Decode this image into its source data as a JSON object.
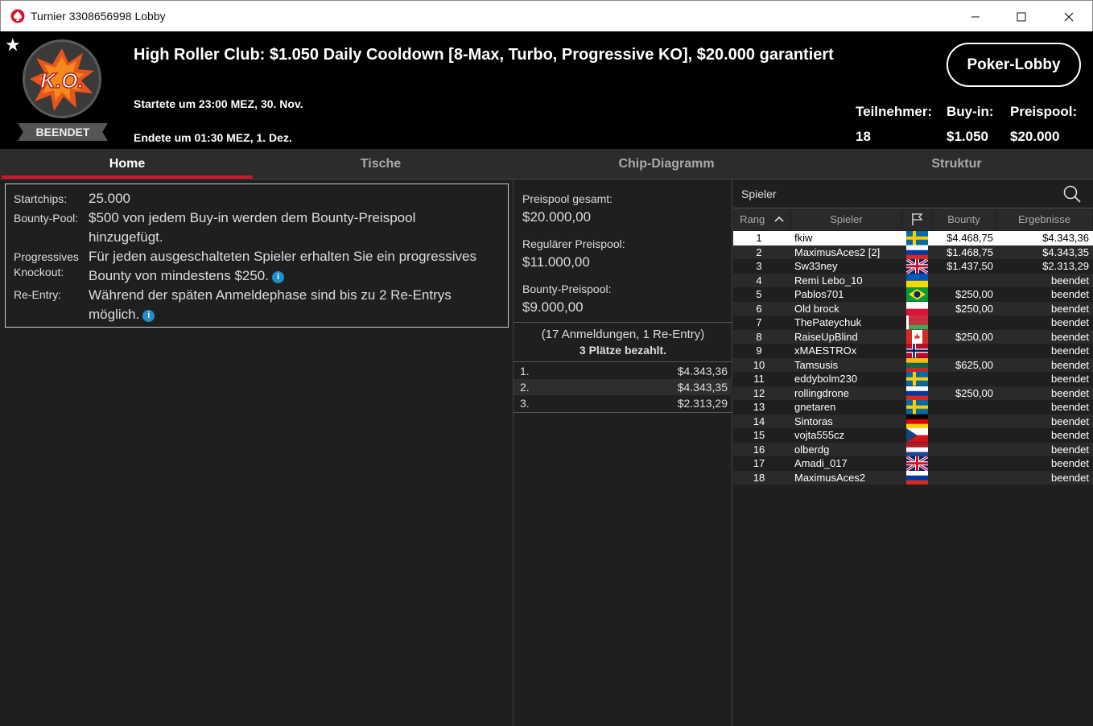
{
  "window": {
    "title": "Turnier 3308656998 Lobby"
  },
  "header": {
    "status": "BEENDET",
    "title": "High Roller Club: $1.050 Daily Cooldown [8-Max, Turbo, Progressive KO], $20.000 garantiert",
    "started": "Startete um 23:00 MEZ, 30. Nov.",
    "ended": "Endete um 01:30 MEZ, 1. Dez.",
    "lobby_button": "Poker-Lobby",
    "participants_label": "Teilnehmer:",
    "participants_value": "18",
    "buyin_label": "Buy-in:",
    "buyin_value": "$1.050",
    "prizepool_label": "Preispool:",
    "prizepool_value": "$20.000"
  },
  "tabs": [
    "Home",
    "Tische",
    "Chip-Diagramm",
    "Struktur"
  ],
  "info": {
    "startchips_label": "Startchips:",
    "startchips_value": "25.000",
    "bounty_label": "Bounty-Pool:",
    "bounty_value_1": "$500 von jedem Buy-in werden dem Bounty-Preispool",
    "bounty_value_2": "hinzugefügt.",
    "pko_label_1": "Progressives",
    "pko_label_2": "Knockout:",
    "pko_value_1": "Für jeden ausgeschalteten Spieler erhalten Sie ein progressives",
    "pko_value_2": "Bounty von mindestens $250.",
    "reentry_label": "Re-Entry:",
    "reentry_value_1": "Während der späten Anmeldephase sind bis zu 2 Re-Entrys",
    "reentry_value_2": "möglich."
  },
  "prize": {
    "total_label": "Preispool gesamt:",
    "total_value": "$20.000,00",
    "regular_label": "Regulärer Preispool:",
    "regular_value": "$11.000,00",
    "bounty_label": "Bounty-Preispool:",
    "bounty_value": "$9.000,00",
    "entries": "(17 Anmeldungen, 1 Re-Entry)",
    "paid": "3 Plätze bezahlt.",
    "payouts": [
      {
        "pos": "1.",
        "amount": "$4.343,36"
      },
      {
        "pos": "2.",
        "amount": "$4.343,35"
      },
      {
        "pos": "3.",
        "amount": "$2.313,29"
      }
    ]
  },
  "players": {
    "title": "Spieler",
    "columns": {
      "rank": "Rang",
      "player": "Spieler",
      "bounty": "Bounty",
      "result": "Ergebnisse"
    },
    "rows": [
      {
        "rank": "1",
        "name": "fkiw",
        "flag": "se",
        "bounty": "$4.468,75",
        "result": "$4.343,36"
      },
      {
        "rank": "2",
        "name": "MaximusAces2 [2]",
        "flag": "ru",
        "bounty": "$1.468,75",
        "result": "$4.343,35"
      },
      {
        "rank": "3",
        "name": "Sw33ney",
        "flag": "gb",
        "bounty": "$1.437,50",
        "result": "$2.313,29"
      },
      {
        "rank": "4",
        "name": "Remi Lebo_10",
        "flag": "ua",
        "bounty": "",
        "result": "beendet"
      },
      {
        "rank": "5",
        "name": "Pablos701",
        "flag": "br",
        "bounty": "$250,00",
        "result": "beendet"
      },
      {
        "rank": "6",
        "name": "Old brock",
        "flag": "pl",
        "bounty": "$250,00",
        "result": "beendet"
      },
      {
        "rank": "7",
        "name": "ThePateychuk",
        "flag": "by",
        "bounty": "",
        "result": "beendet"
      },
      {
        "rank": "8",
        "name": "RaiseUpBlind",
        "flag": "ca",
        "bounty": "$250,00",
        "result": "beendet"
      },
      {
        "rank": "9",
        "name": "xMAESTROx",
        "flag": "no",
        "bounty": "",
        "result": "beendet"
      },
      {
        "rank": "10",
        "name": "Tamsusis",
        "flag": "lt",
        "bounty": "$625,00",
        "result": "beendet"
      },
      {
        "rank": "11",
        "name": "eddybolm230",
        "flag": "se",
        "bounty": "",
        "result": "beendet"
      },
      {
        "rank": "12",
        "name": "rollingdrone",
        "flag": "ru",
        "bounty": "$250,00",
        "result": "beendet"
      },
      {
        "rank": "13",
        "name": "gnetaren",
        "flag": "se",
        "bounty": "",
        "result": "beendet"
      },
      {
        "rank": "14",
        "name": "Sintoras",
        "flag": "de",
        "bounty": "",
        "result": "beendet"
      },
      {
        "rank": "15",
        "name": "vojta555cz",
        "flag": "cz",
        "bounty": "",
        "result": "beendet"
      },
      {
        "rank": "16",
        "name": "olberdg",
        "flag": "nl",
        "bounty": "",
        "result": "beendet"
      },
      {
        "rank": "17",
        "name": "Amadi_017",
        "flag": "gb",
        "bounty": "",
        "result": "beendet"
      },
      {
        "rank": "18",
        "name": "MaximusAces2",
        "flag": "ru",
        "bounty": "",
        "result": "beendet"
      }
    ]
  },
  "colors": {
    "accent": "#d4142a",
    "info": "#1f8fc9",
    "background": "#1f1f1f"
  }
}
